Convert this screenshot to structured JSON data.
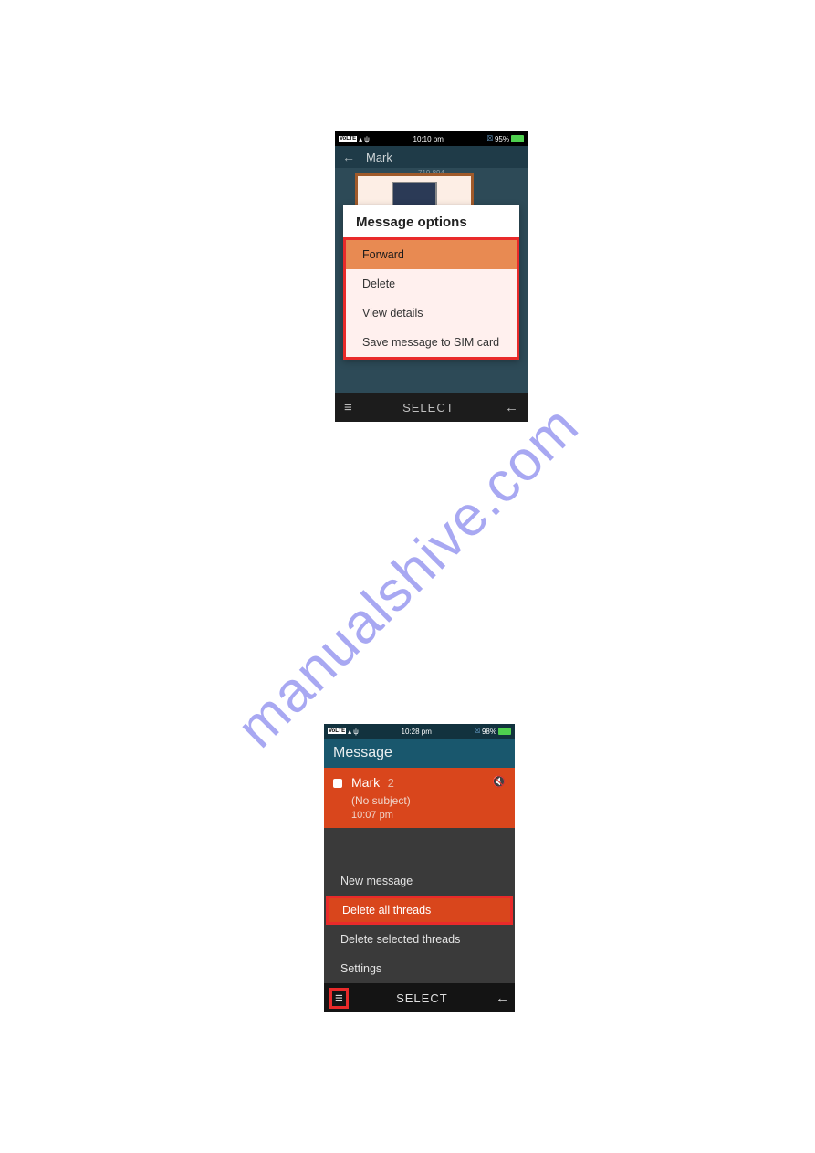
{
  "watermark": "manualshive.com",
  "phone1": {
    "status": {
      "time": "10:10 pm",
      "battery": "95%"
    },
    "header": {
      "title": "Mark",
      "subtitle": "719 894"
    },
    "dialog": {
      "title": "Message options",
      "items": [
        "Forward",
        "Delete",
        "View details",
        "Save message to SIM card"
      ]
    },
    "nav": {
      "select": "SELECT"
    }
  },
  "phone2": {
    "status": {
      "time": "10:28 pm",
      "battery": "98%"
    },
    "header": {
      "title": "Message"
    },
    "thread": {
      "name": "Mark",
      "count": "2",
      "subject": "(No subject)",
      "time": "10:07 pm"
    },
    "menu": {
      "items": [
        "New message",
        "Delete all threads",
        "Delete selected threads",
        "Settings"
      ]
    },
    "nav": {
      "select": "SELECT"
    }
  }
}
